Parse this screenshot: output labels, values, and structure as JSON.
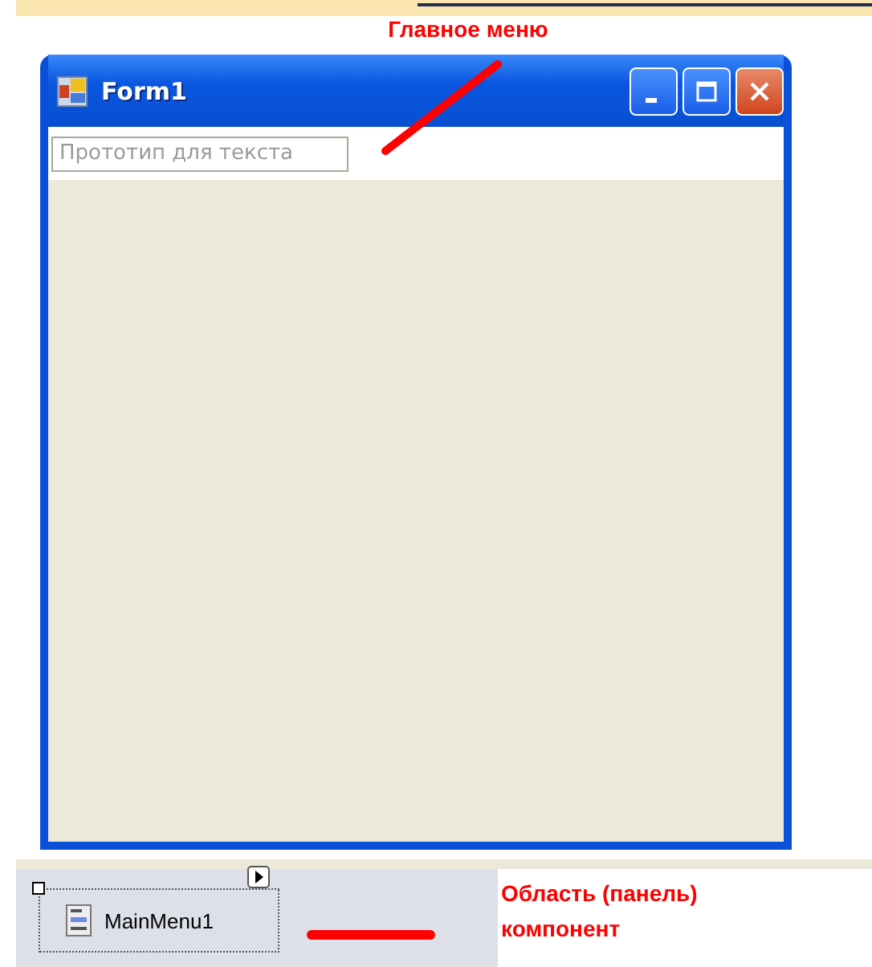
{
  "annotations": {
    "main_menu": "Главное меню",
    "component_tray": "Область (панель) компонент"
  },
  "window": {
    "title": "Form1",
    "menu_placeholder": "Прототип для текста"
  },
  "component_tray": {
    "components": [
      {
        "name": "MainMenu1",
        "selected": true
      }
    ]
  }
}
